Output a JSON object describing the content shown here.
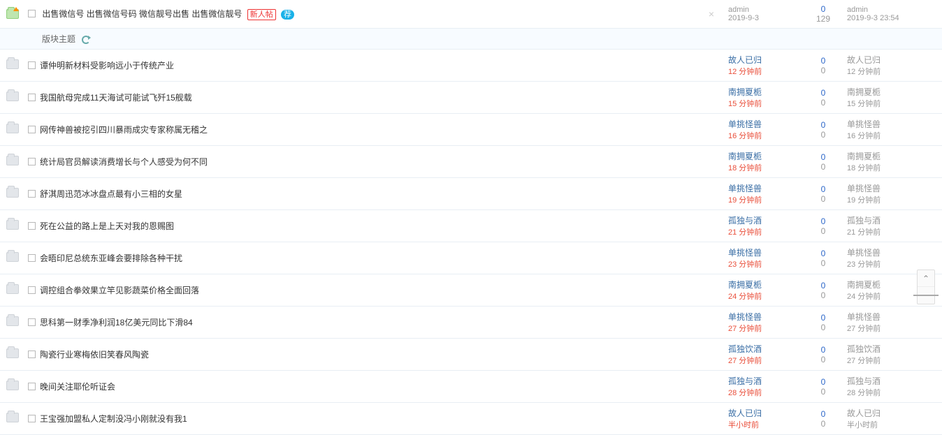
{
  "section_label": "版块主题",
  "sticky": {
    "title": "出售微信号 出售微信号码 微信靓号出售 出售微信靓号",
    "badge_new": "新人帖",
    "badge_ess": "荐",
    "author": "admin",
    "author_date": "2019-9-3",
    "views": "0",
    "replies": "129",
    "last_author": "admin",
    "last_time": "2019-9-3 23:54"
  },
  "threads": [
    {
      "title": "谭仲明新材料受影响远小于传统产业",
      "author": "故人已归",
      "time": "12 分钟前",
      "views": "0",
      "replies": "0",
      "last_author": "故人已归",
      "last_time": "12 分钟前"
    },
    {
      "title": "我国航母完成11天海试可能试飞歼15舰载",
      "author": "南拥夏栀",
      "time": "15 分钟前",
      "views": "0",
      "replies": "0",
      "last_author": "南拥夏栀",
      "last_time": "15 分钟前"
    },
    {
      "title": "网传神兽被挖引四川暴雨成灾专家称属无稽之",
      "author": "单挑怪兽",
      "time": "16 分钟前",
      "views": "0",
      "replies": "0",
      "last_author": "单挑怪兽",
      "last_time": "16 分钟前"
    },
    {
      "title": "统计局官员解读消费增长与个人感受为何不同",
      "author": "南拥夏栀",
      "time": "18 分钟前",
      "views": "0",
      "replies": "0",
      "last_author": "南拥夏栀",
      "last_time": "18 分钟前"
    },
    {
      "title": "舒淇周迅范冰冰盘点最有小三相的女星",
      "author": "单挑怪兽",
      "time": "19 分钟前",
      "views": "0",
      "replies": "0",
      "last_author": "单挑怪兽",
      "last_time": "19 分钟前"
    },
    {
      "title": "死在公益的路上是上天对我的恩赐图",
      "author": "孤独与酒",
      "time": "21 分钟前",
      "views": "0",
      "replies": "0",
      "last_author": "孤独与酒",
      "last_time": "21 分钟前"
    },
    {
      "title": "会晤印尼总统东亚峰会要排除各种干扰",
      "author": "单挑怪兽",
      "time": "23 分钟前",
      "views": "0",
      "replies": "0",
      "last_author": "单挑怪兽",
      "last_time": "23 分钟前"
    },
    {
      "title": "调控组合拳效果立竿见影蔬菜价格全面回落",
      "author": "南拥夏栀",
      "time": "24 分钟前",
      "views": "0",
      "replies": "0",
      "last_author": "南拥夏栀",
      "last_time": "24 分钟前"
    },
    {
      "title": "思科第一财季净利润18亿美元同比下滑84",
      "author": "单挑怪兽",
      "time": "27 分钟前",
      "views": "0",
      "replies": "0",
      "last_author": "单挑怪兽",
      "last_time": "27 分钟前"
    },
    {
      "title": "陶瓷行业寒梅依旧笑春风陶瓷",
      "author": "孤独饮酒",
      "time": "27 分钟前",
      "views": "0",
      "replies": "0",
      "last_author": "孤独饮酒",
      "last_time": "27 分钟前"
    },
    {
      "title": "晚间关注耶伦听证会",
      "author": "孤独与酒",
      "time": "28 分钟前",
      "views": "0",
      "replies": "0",
      "last_author": "孤独与酒",
      "last_time": "28 分钟前"
    },
    {
      "title": "王宝强加盟私人定制没冯小刚就没有我1",
      "author": "故人已归",
      "time": "半小时前",
      "views": "0",
      "replies": "0",
      "last_author": "故人已归",
      "last_time": "半小时前"
    }
  ]
}
